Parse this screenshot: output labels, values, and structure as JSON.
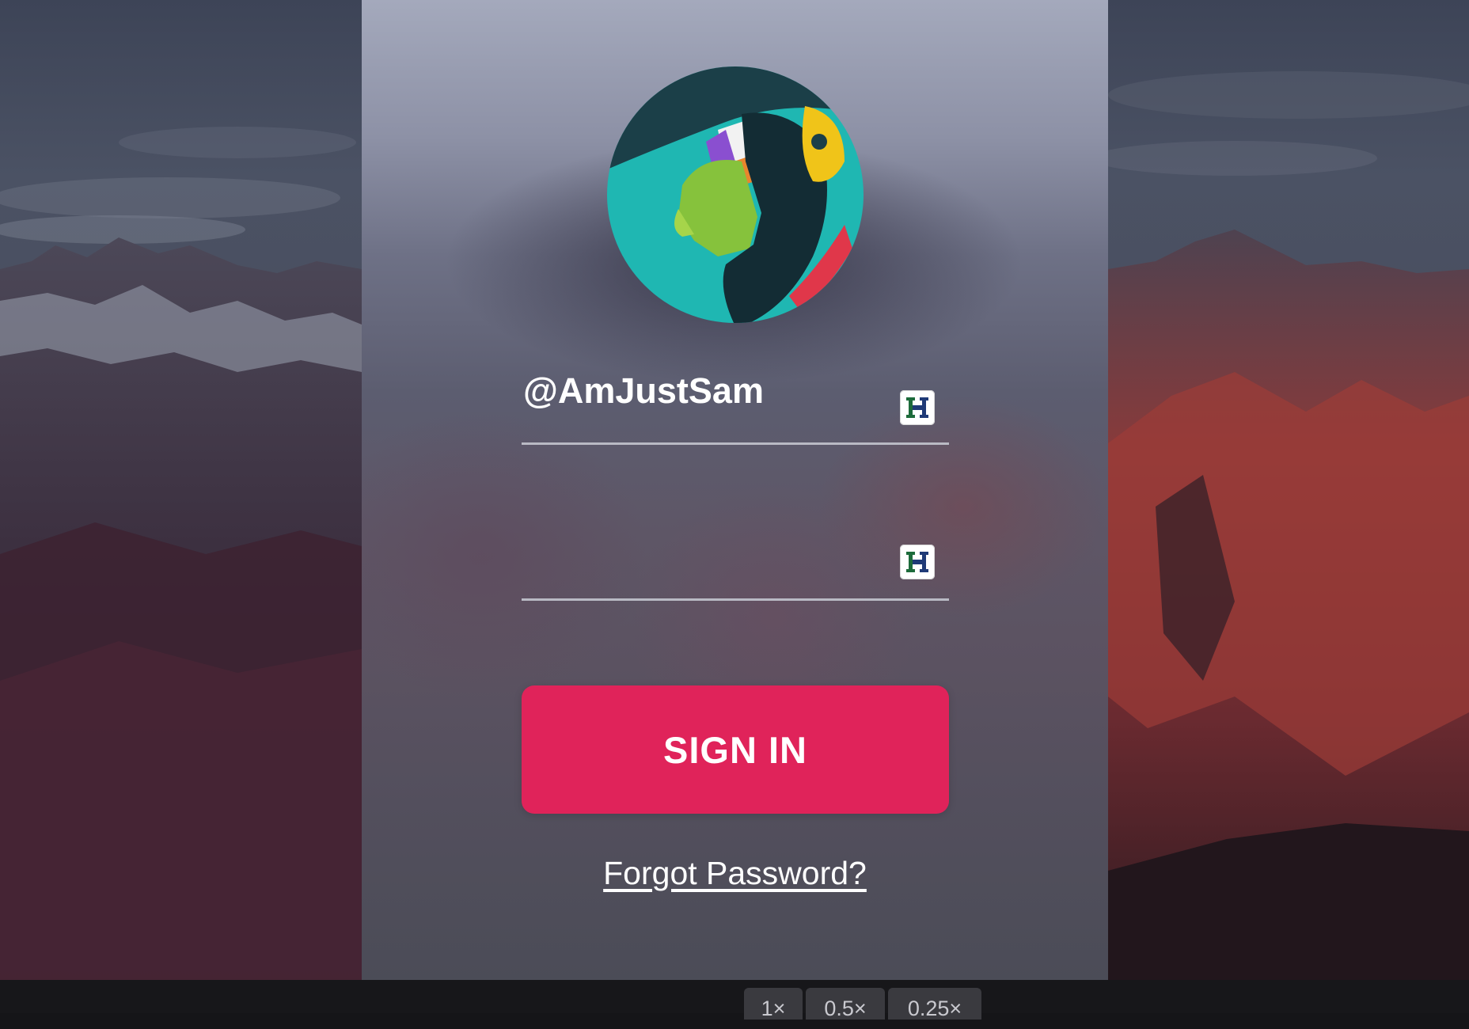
{
  "login": {
    "username_value": "@AmJustSam",
    "password_value": "",
    "username_field_icon": "password-manager-icon",
    "password_field_icon": "password-manager-icon",
    "signin_label": "SIGN IN",
    "forgot_label": "Forgot Password?"
  },
  "avatar": {
    "icon": "profile-avatar-illustration"
  },
  "zoom_controls": {
    "options": [
      "1×",
      "0.5×",
      "0.25×"
    ]
  },
  "colors": {
    "accent": "#e0235a",
    "panel_top": "#a4a9bc",
    "panel_bottom": "#4b4c57",
    "toolbar": "#17171a"
  }
}
